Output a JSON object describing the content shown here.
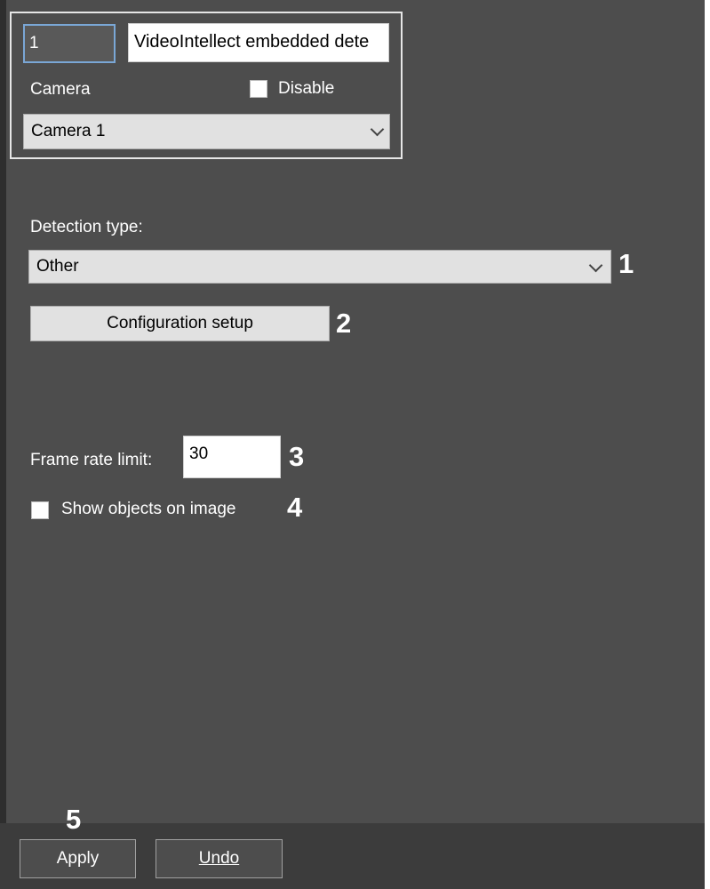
{
  "object": {
    "id_value": "1",
    "name_value": "VideoIntellect embedded dete",
    "camera_label": "Camera",
    "disable_label": "Disable",
    "disable_checked": false,
    "camera_selected": "Camera 1"
  },
  "settings": {
    "detection_type_label": "Detection type:",
    "detection_type_selected": "Other",
    "config_setup_label": "Configuration setup",
    "frame_rate_label": "Frame rate limit:",
    "frame_rate_value": "30",
    "show_objects_label": "Show objects on image",
    "show_objects_checked": false
  },
  "callouts": [
    "1",
    "2",
    "3",
    "4",
    "5"
  ],
  "footer": {
    "apply_label": "Apply",
    "undo_label": "Undo"
  },
  "colors": {
    "panel_bg": "#4d4d4d",
    "footer_bg": "#3c3c3c",
    "control_bg": "#e1e1e1",
    "focus_border": "#7aa7d6"
  }
}
